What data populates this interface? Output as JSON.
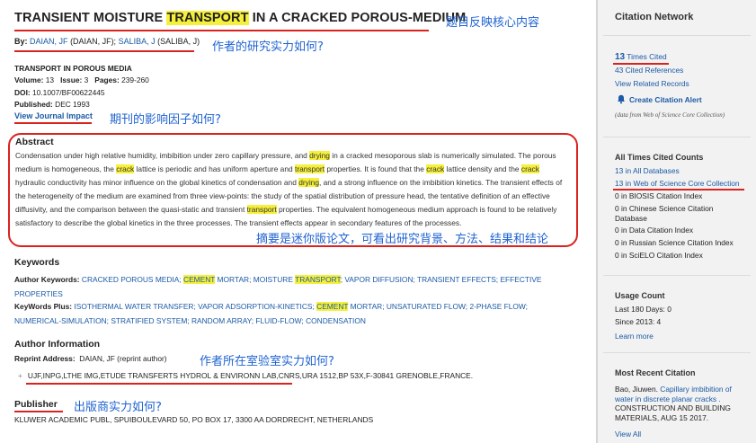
{
  "record": {
    "title_before": "TRANSIENT MOISTURE ",
    "title_hl": "TRANSPORT",
    "title_after": " IN A CRACKED POROUS-MEDIUM",
    "by_label": "By:",
    "author1": "DAIAN, JF",
    "author1_full": "(DAIAN, JF);",
    "author2": "SALIBA, J",
    "author2_full": "(SALIBA, J)",
    "journal": "TRANSPORT IN POROUS MEDIA",
    "volume_label": "Volume:",
    "volume": "13",
    "issue_label": "Issue:",
    "issue": "3",
    "pages_label": "Pages:",
    "pages": "239-260",
    "doi_label": "DOI:",
    "doi": "10.1007/BF00622445",
    "published_label": "Published:",
    "published": "DEC 1993",
    "journal_impact_link": "View Journal Impact"
  },
  "abstract": {
    "heading": "Abstract",
    "segments": [
      "Condensation under high relative humidity, imbibition under zero capillary pressure, and ",
      "drying",
      " in a cracked mesoporous slab is numerically simulated. The porous medium is homogeneous, the ",
      "crack",
      " lattice is periodic and has uniform aperture and ",
      "transport",
      " properties. It is found that the ",
      "crack",
      " lattice density and the ",
      "crack",
      " hydraulic conductivity has minor influence on the global kinetics of condensation and ",
      "drying",
      ", and a strong influence on the imbibition kinetics. The transient effects of the heterogeneity of the medium are examined from three view-points: the study of the spatial distribution of pressure head, the tentative definition of an effective diffusivity, and the comparison between the quasi-static and transient ",
      "transport",
      " properties. The equivalent homogeneous medium approach is found to be relatively satisfactory to describe the global kinetics in the three processes. The transient effects appear in secondary features of the processes."
    ]
  },
  "keywords": {
    "heading": "Keywords",
    "author_label": "Author Keywords:",
    "author_segments": [
      "CRACKED POROUS MEDIA; ",
      "CEMENT",
      " MORTAR; MOISTURE ",
      "TRANSPORT",
      "; VAPOR DIFFUSION; TRANSIENT EFFECTS; EFFECTIVE PROPERTIES"
    ],
    "plus_label": "KeyWords Plus:",
    "plus_segments": [
      "ISOTHERMAL WATER TRANSFER; VAPOR ADSORPTION-KINETICS; ",
      "CEMENT",
      " MORTAR; UNSATURATED FLOW; 2-PHASE FLOW; NUMERICAL-SIMULATION; STRATIFIED SYSTEM; RANDOM ARRAY; FLUID-FLOW; CONDENSATION"
    ]
  },
  "author_info": {
    "heading": "Author Information",
    "reprint_label": "Reprint Address:",
    "reprint_value": "DAIAN, JF (reprint author)",
    "expand": "+",
    "address": "UJF,INPG,LTHE IMG,ETUDE TRANSFERTS HYDROL & ENVIRONN LAB,CNRS,URA 1512,BP 53X,F-30841 GRENOBLE,FRANCE."
  },
  "publisher": {
    "heading": "Publisher",
    "value": "KLUWER ACADEMIC PUBL, SPUIBOULEVARD 50, PO BOX 17, 3300 AA DORDRECHT, NETHERLANDS"
  },
  "sidebar": {
    "citation_network": "Citation Network",
    "times_cited_num": "13",
    "times_cited_text": " Times Cited",
    "cited_references": "43 Cited References",
    "view_related": "View Related Records",
    "create_alert": "Create Citation Alert",
    "data_source": "(data from Web of Science Core Collection)",
    "all_times_heading": "All Times Cited Counts",
    "all_db": "13 in All Databases",
    "wos_core": "13 in Web of Science Core Collection",
    "biosis": "0 in BIOSIS Citation Index",
    "chinese": "0 in Chinese Science Citation Database",
    "data_citation": "0 in Data Citation Index",
    "russian": "0 in Russian Science Citation Index",
    "scielo": "0 in SciELO Citation Index",
    "usage_heading": "Usage Count",
    "last_180": "Last 180 Days: 0",
    "since_2013": "Since 2013: 4",
    "learn_more": "Learn more",
    "recent_heading": "Most Recent Citation",
    "recent_author": "Bao, Jiuwen. ",
    "recent_title": "Capillary imbibition of water in discrete planar cracks .",
    "recent_source": "CONSTRUCTION AND BUILDING MATERIALS, AUG 15 2017.",
    "view_all": "View All"
  },
  "annotations": {
    "title_note": "题目反映核心内容",
    "authors_note": "作者的研究实力如何?",
    "journal_note": "期刊的影响因子如何?",
    "abstract_note": "摘要是迷你版论文，可看出研究背景、方法、结果和结论",
    "lab_note": "作者所在室验室实力如何?",
    "publisher_note": "出版商实力如何?"
  },
  "colors": {
    "highlight": "#f6f03a",
    "link": "#1b5aa6",
    "annotation_red": "#d9231f",
    "annotation_blue": "#1f63d1"
  }
}
